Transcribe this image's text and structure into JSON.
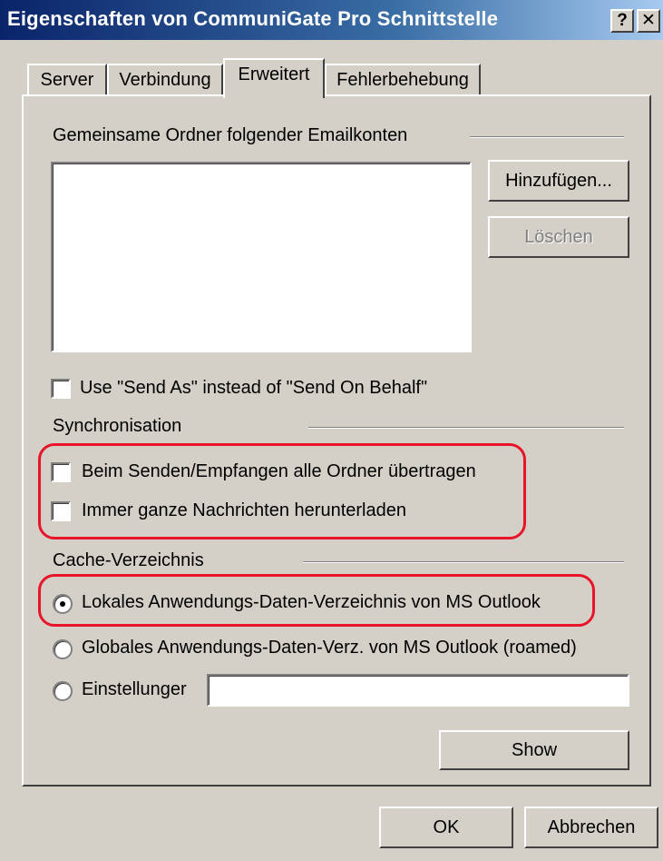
{
  "window": {
    "title": "Eigenschaften von CommuniGate Pro Schnittstelle",
    "help_button": "?",
    "close_button": "✕"
  },
  "tabs": [
    {
      "label": "Server",
      "active": false
    },
    {
      "label": "Verbindung",
      "active": false
    },
    {
      "label": "Erweitert",
      "active": true
    },
    {
      "label": "Fehlerbehebung",
      "active": false
    }
  ],
  "shared_folders": {
    "group_label": "Gemeinsame Ordner folgender Emailkonten",
    "accounts": [],
    "add_button": "Hinzufügen...",
    "delete_button": "Löschen"
  },
  "send_as": {
    "label": "Use \"Send As\" instead of \"Send On Behalf\"",
    "checked": false
  },
  "sync": {
    "group_label": "Synchronisation",
    "options": [
      {
        "label": "Beim Senden/Empfangen alle Ordner übertragen",
        "checked": false
      },
      {
        "label": "Immer ganze Nachrichten herunterladen",
        "checked": false
      }
    ]
  },
  "cache": {
    "group_label": "Cache-Verzeichnis",
    "options": [
      {
        "label": "Lokales Anwendungs-Daten-Verzeichnis von MS Outlook",
        "selected": true
      },
      {
        "label": "Globales Anwendungs-Daten-Verz. von MS Outlook (roamed)",
        "selected": false
      },
      {
        "label": "Einstellunger",
        "selected": false
      }
    ],
    "custom_path_value": "",
    "show_button": "Show"
  },
  "footer": {
    "ok_button": "OK",
    "cancel_button": "Abbrechen"
  },
  "colors": {
    "titlebar_start": "#0a246a",
    "titlebar_end": "#a6caf0",
    "dialog_face": "#d4d0c8",
    "highlight": "#e8142a"
  }
}
